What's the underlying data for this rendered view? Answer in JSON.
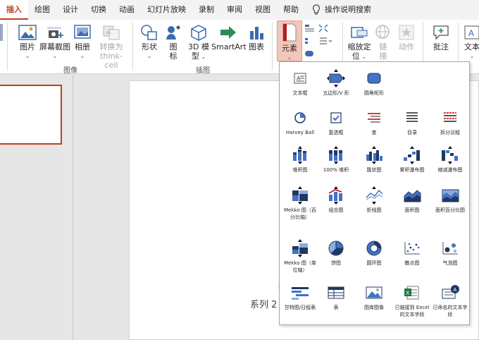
{
  "tabs": [
    "插入",
    "绘图",
    "设计",
    "切换",
    "动画",
    "幻灯片放映",
    "录制",
    "审阅",
    "视图",
    "帮助"
  ],
  "search_label": "操作说明搜索",
  "ribbon": {
    "picture": "图片",
    "screenshot": "屏幕截图",
    "album": "相册",
    "convert_think_cell": [
      "转换为",
      "think-cell"
    ],
    "group_image": "图像",
    "shapes": "形状",
    "icons": [
      "图",
      "标"
    ],
    "model3d": [
      "3D 模",
      "型"
    ],
    "smartart": "SmartArt",
    "chart": "图表",
    "group_illustration": "插图",
    "elements": "元素",
    "zoom_position": [
      "缩放定",
      "位"
    ],
    "link": [
      "链",
      "接"
    ],
    "action": "动作",
    "comment": "批注",
    "text": "文本"
  },
  "slide_series_label": "系列 2",
  "dropdown_items": [
    {
      "label": "文本框"
    },
    {
      "label": "五边形/V 形"
    },
    {
      "label": "圆角矩形"
    },
    {
      "label": "Harvey Ball"
    },
    {
      "label": "复选框"
    },
    {
      "label": "查"
    },
    {
      "label": "目录"
    },
    {
      "label": "拆分议程"
    },
    {
      "label": "堆积图"
    },
    {
      "label": "100% 堆积"
    },
    {
      "label": "簇状图"
    },
    {
      "label": "累积瀑布图"
    },
    {
      "label": "缩减瀑布图"
    },
    {
      "label": "Mekko 图（百分比轴）"
    },
    {
      "label": "组合图"
    },
    {
      "label": "折线图"
    },
    {
      "label": "面积图"
    },
    {
      "label": "面积百分比图"
    },
    {
      "label": "Mekko 图（单位轴）"
    },
    {
      "label": "饼图"
    },
    {
      "label": "圆环图"
    },
    {
      "label": "散点图"
    },
    {
      "label": "气泡图"
    },
    {
      "label": "甘特图/日程表"
    },
    {
      "label": "表"
    },
    {
      "label": "图库图像"
    },
    {
      "label": "已链接到 Excel 的文本字段"
    },
    {
      "label": "已命名的文本字段"
    }
  ],
  "colors": {
    "accent": "#c43e1c",
    "chart_blue": "#4472c4",
    "navy": "#1f3864",
    "red": "#c00000"
  }
}
